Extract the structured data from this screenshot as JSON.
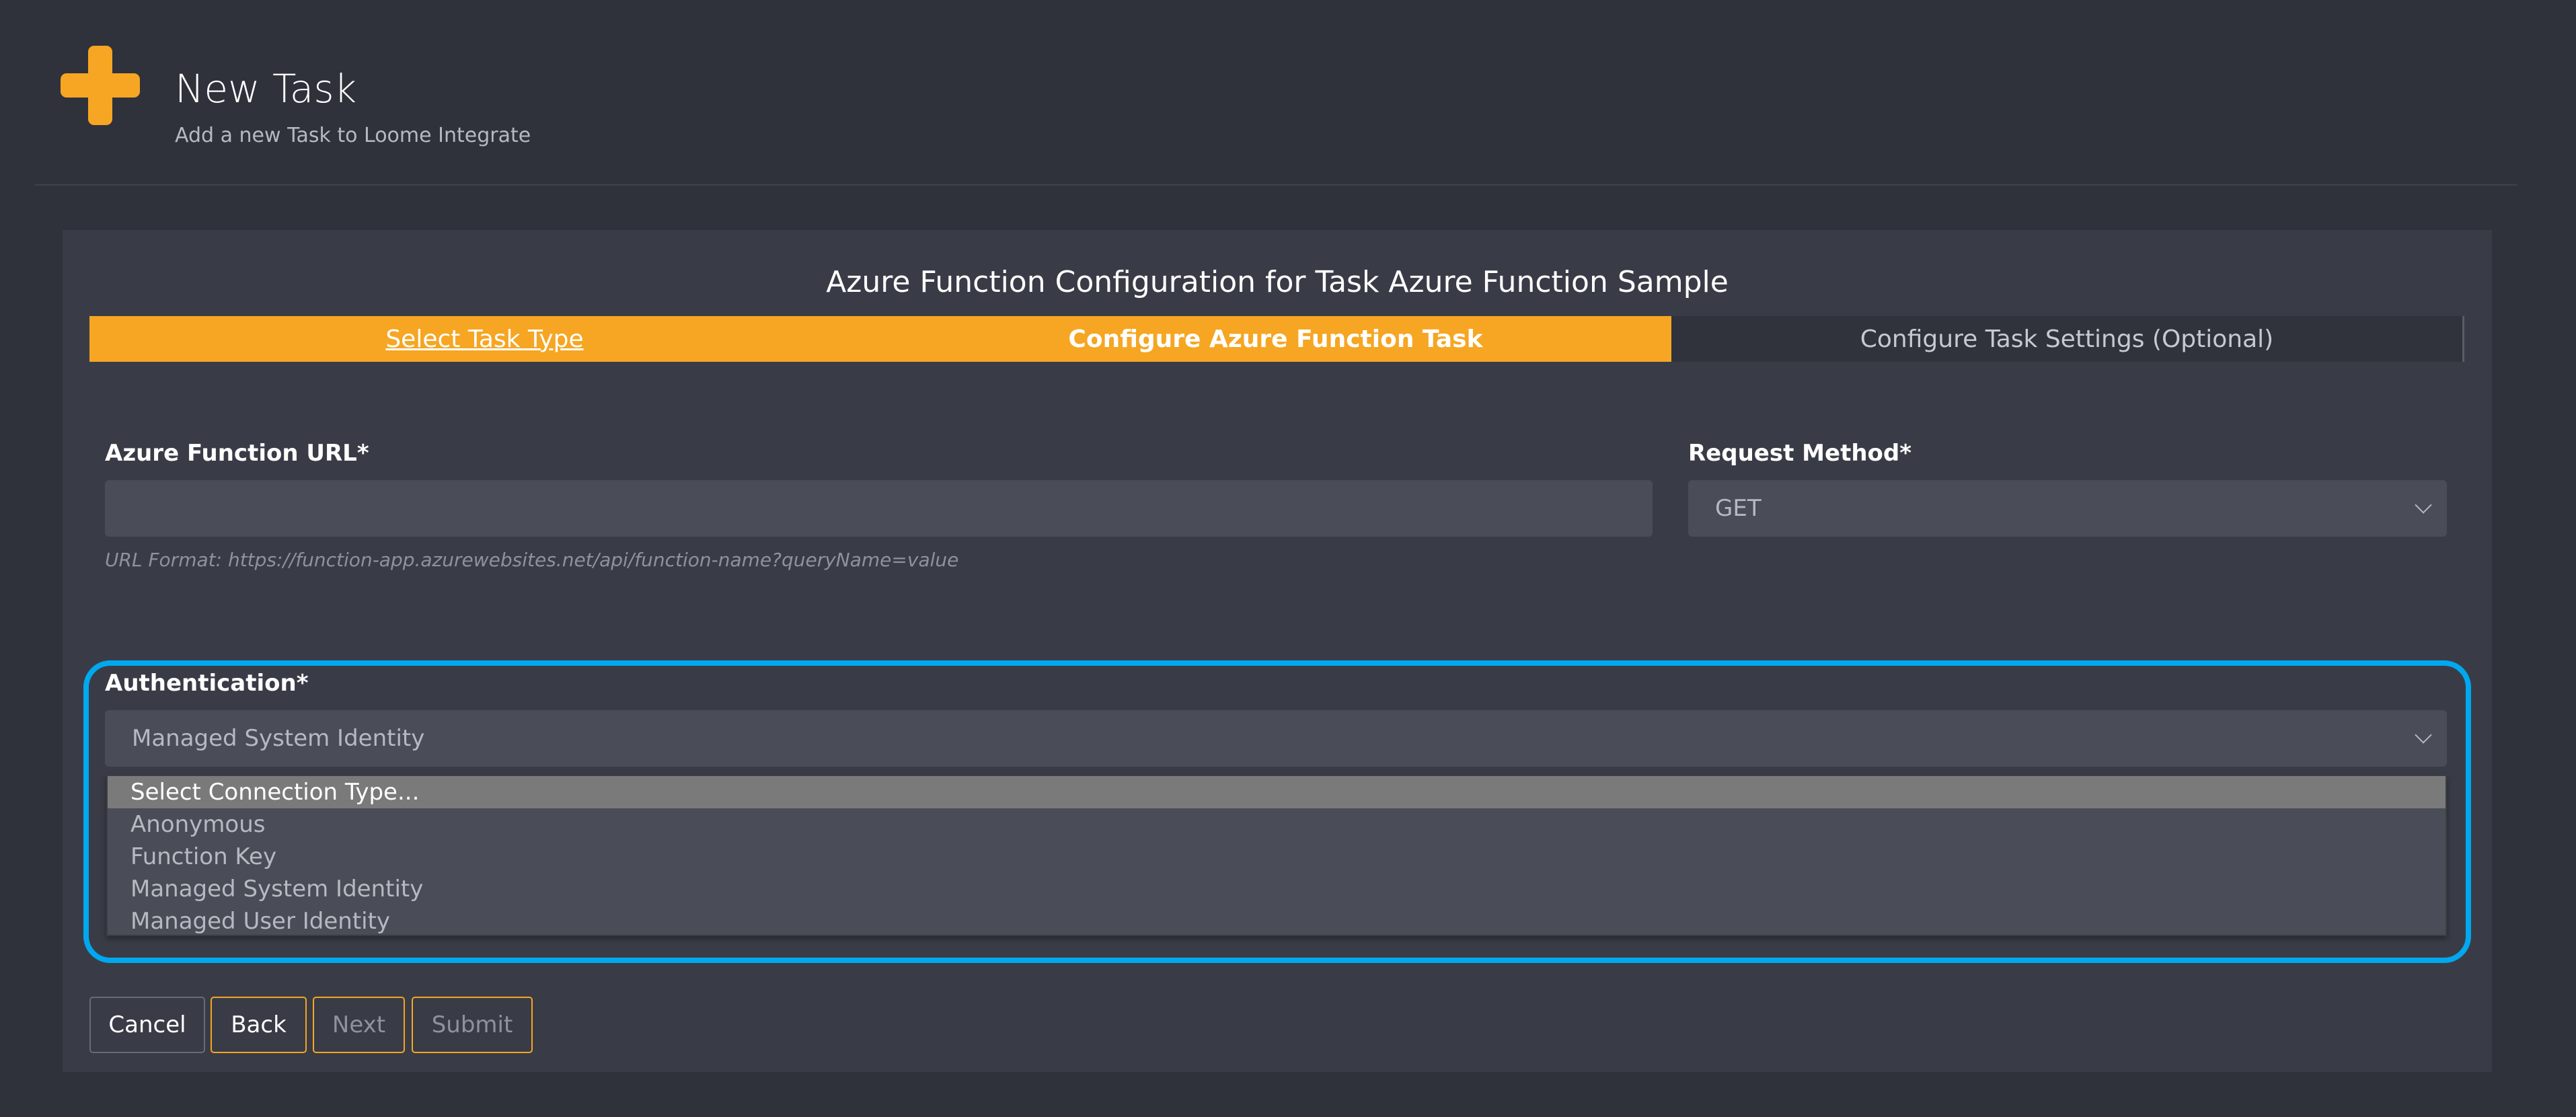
{
  "header": {
    "title": "New Task",
    "subtitle": "Add a new Task to Loome Integrate"
  },
  "card": {
    "title": "Azure Function Configuration for Task Azure Function Sample"
  },
  "stepper": {
    "steps": [
      {
        "label": "Select Task Type",
        "state": "completed"
      },
      {
        "label": "Configure Azure Function Task",
        "state": "active"
      },
      {
        "label": "Configure Task Settings (Optional)",
        "state": "pending"
      }
    ]
  },
  "form": {
    "url": {
      "label": "Azure Function URL*",
      "value": "",
      "hint": "URL Format: https://function-app.azurewebsites.net/api/function-name?queryName=value"
    },
    "method": {
      "label": "Request Method*",
      "value": "GET"
    },
    "auth": {
      "label": "Authentication*",
      "value": "Managed System Identity",
      "options": [
        "Select Connection Type...",
        "Anonymous",
        "Function Key",
        "Managed System Identity",
        "Managed User Identity"
      ],
      "highlighted_option": "Select Connection Type..."
    }
  },
  "buttons": {
    "cancel": "Cancel",
    "back": "Back",
    "next": "Next",
    "submit": "Submit"
  },
  "colors": {
    "accent": "#f6a623",
    "highlight": "#00a8f0",
    "background": "#2f323b",
    "card": "#393c46",
    "input": "#4a4d57"
  },
  "icons": {
    "header": "plus-icon",
    "select": "chevron-down-icon"
  }
}
